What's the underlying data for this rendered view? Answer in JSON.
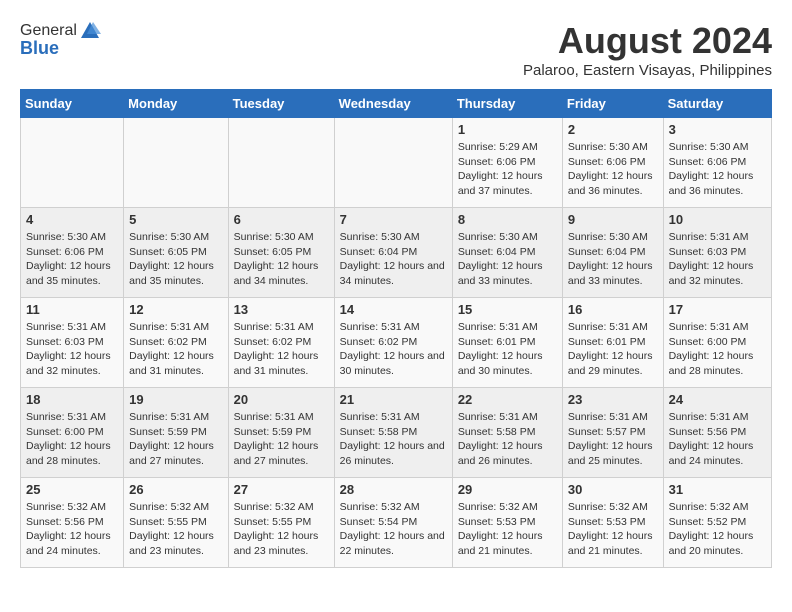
{
  "header": {
    "logo_general": "General",
    "logo_blue": "Blue",
    "month_year": "August 2024",
    "location": "Palaroo, Eastern Visayas, Philippines"
  },
  "days_of_week": [
    "Sunday",
    "Monday",
    "Tuesday",
    "Wednesday",
    "Thursday",
    "Friday",
    "Saturday"
  ],
  "weeks": [
    [
      {
        "day": "",
        "sunrise": "",
        "sunset": "",
        "daylight": ""
      },
      {
        "day": "",
        "sunrise": "",
        "sunset": "",
        "daylight": ""
      },
      {
        "day": "",
        "sunrise": "",
        "sunset": "",
        "daylight": ""
      },
      {
        "day": "",
        "sunrise": "",
        "sunset": "",
        "daylight": ""
      },
      {
        "day": "1",
        "sunrise": "Sunrise: 5:29 AM",
        "sunset": "Sunset: 6:06 PM",
        "daylight": "Daylight: 12 hours and 37 minutes."
      },
      {
        "day": "2",
        "sunrise": "Sunrise: 5:30 AM",
        "sunset": "Sunset: 6:06 PM",
        "daylight": "Daylight: 12 hours and 36 minutes."
      },
      {
        "day": "3",
        "sunrise": "Sunrise: 5:30 AM",
        "sunset": "Sunset: 6:06 PM",
        "daylight": "Daylight: 12 hours and 36 minutes."
      }
    ],
    [
      {
        "day": "4",
        "sunrise": "Sunrise: 5:30 AM",
        "sunset": "Sunset: 6:06 PM",
        "daylight": "Daylight: 12 hours and 35 minutes."
      },
      {
        "day": "5",
        "sunrise": "Sunrise: 5:30 AM",
        "sunset": "Sunset: 6:05 PM",
        "daylight": "Daylight: 12 hours and 35 minutes."
      },
      {
        "day": "6",
        "sunrise": "Sunrise: 5:30 AM",
        "sunset": "Sunset: 6:05 PM",
        "daylight": "Daylight: 12 hours and 34 minutes."
      },
      {
        "day": "7",
        "sunrise": "Sunrise: 5:30 AM",
        "sunset": "Sunset: 6:04 PM",
        "daylight": "Daylight: 12 hours and 34 minutes."
      },
      {
        "day": "8",
        "sunrise": "Sunrise: 5:30 AM",
        "sunset": "Sunset: 6:04 PM",
        "daylight": "Daylight: 12 hours and 33 minutes."
      },
      {
        "day": "9",
        "sunrise": "Sunrise: 5:30 AM",
        "sunset": "Sunset: 6:04 PM",
        "daylight": "Daylight: 12 hours and 33 minutes."
      },
      {
        "day": "10",
        "sunrise": "Sunrise: 5:31 AM",
        "sunset": "Sunset: 6:03 PM",
        "daylight": "Daylight: 12 hours and 32 minutes."
      }
    ],
    [
      {
        "day": "11",
        "sunrise": "Sunrise: 5:31 AM",
        "sunset": "Sunset: 6:03 PM",
        "daylight": "Daylight: 12 hours and 32 minutes."
      },
      {
        "day": "12",
        "sunrise": "Sunrise: 5:31 AM",
        "sunset": "Sunset: 6:02 PM",
        "daylight": "Daylight: 12 hours and 31 minutes."
      },
      {
        "day": "13",
        "sunrise": "Sunrise: 5:31 AM",
        "sunset": "Sunset: 6:02 PM",
        "daylight": "Daylight: 12 hours and 31 minutes."
      },
      {
        "day": "14",
        "sunrise": "Sunrise: 5:31 AM",
        "sunset": "Sunset: 6:02 PM",
        "daylight": "Daylight: 12 hours and 30 minutes."
      },
      {
        "day": "15",
        "sunrise": "Sunrise: 5:31 AM",
        "sunset": "Sunset: 6:01 PM",
        "daylight": "Daylight: 12 hours and 30 minutes."
      },
      {
        "day": "16",
        "sunrise": "Sunrise: 5:31 AM",
        "sunset": "Sunset: 6:01 PM",
        "daylight": "Daylight: 12 hours and 29 minutes."
      },
      {
        "day": "17",
        "sunrise": "Sunrise: 5:31 AM",
        "sunset": "Sunset: 6:00 PM",
        "daylight": "Daylight: 12 hours and 28 minutes."
      }
    ],
    [
      {
        "day": "18",
        "sunrise": "Sunrise: 5:31 AM",
        "sunset": "Sunset: 6:00 PM",
        "daylight": "Daylight: 12 hours and 28 minutes."
      },
      {
        "day": "19",
        "sunrise": "Sunrise: 5:31 AM",
        "sunset": "Sunset: 5:59 PM",
        "daylight": "Daylight: 12 hours and 27 minutes."
      },
      {
        "day": "20",
        "sunrise": "Sunrise: 5:31 AM",
        "sunset": "Sunset: 5:59 PM",
        "daylight": "Daylight: 12 hours and 27 minutes."
      },
      {
        "day": "21",
        "sunrise": "Sunrise: 5:31 AM",
        "sunset": "Sunset: 5:58 PM",
        "daylight": "Daylight: 12 hours and 26 minutes."
      },
      {
        "day": "22",
        "sunrise": "Sunrise: 5:31 AM",
        "sunset": "Sunset: 5:58 PM",
        "daylight": "Daylight: 12 hours and 26 minutes."
      },
      {
        "day": "23",
        "sunrise": "Sunrise: 5:31 AM",
        "sunset": "Sunset: 5:57 PM",
        "daylight": "Daylight: 12 hours and 25 minutes."
      },
      {
        "day": "24",
        "sunrise": "Sunrise: 5:31 AM",
        "sunset": "Sunset: 5:56 PM",
        "daylight": "Daylight: 12 hours and 24 minutes."
      }
    ],
    [
      {
        "day": "25",
        "sunrise": "Sunrise: 5:32 AM",
        "sunset": "Sunset: 5:56 PM",
        "daylight": "Daylight: 12 hours and 24 minutes."
      },
      {
        "day": "26",
        "sunrise": "Sunrise: 5:32 AM",
        "sunset": "Sunset: 5:55 PM",
        "daylight": "Daylight: 12 hours and 23 minutes."
      },
      {
        "day": "27",
        "sunrise": "Sunrise: 5:32 AM",
        "sunset": "Sunset: 5:55 PM",
        "daylight": "Daylight: 12 hours and 23 minutes."
      },
      {
        "day": "28",
        "sunrise": "Sunrise: 5:32 AM",
        "sunset": "Sunset: 5:54 PM",
        "daylight": "Daylight: 12 hours and 22 minutes."
      },
      {
        "day": "29",
        "sunrise": "Sunrise: 5:32 AM",
        "sunset": "Sunset: 5:53 PM",
        "daylight": "Daylight: 12 hours and 21 minutes."
      },
      {
        "day": "30",
        "sunrise": "Sunrise: 5:32 AM",
        "sunset": "Sunset: 5:53 PM",
        "daylight": "Daylight: 12 hours and 21 minutes."
      },
      {
        "day": "31",
        "sunrise": "Sunrise: 5:32 AM",
        "sunset": "Sunset: 5:52 PM",
        "daylight": "Daylight: 12 hours and 20 minutes."
      }
    ]
  ]
}
